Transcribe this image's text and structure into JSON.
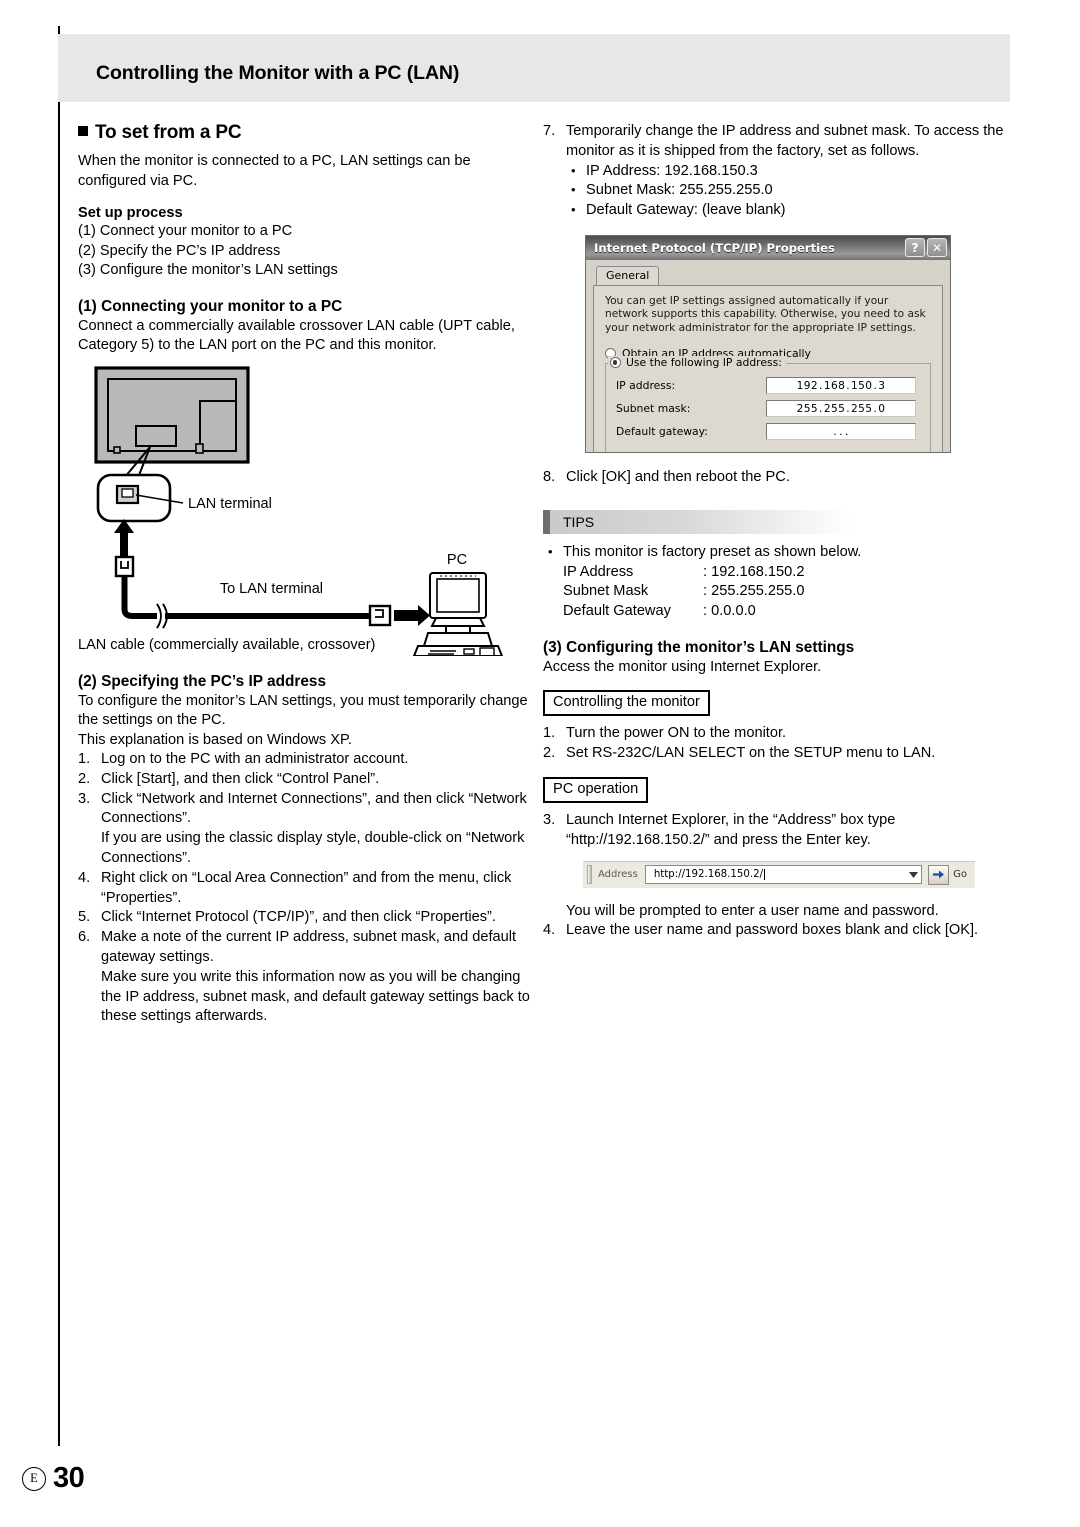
{
  "header": {
    "title": "Controlling the Monitor with a PC (LAN)"
  },
  "left": {
    "section_title": "To set from a PC",
    "intro": "When the monitor is connected to a PC, LAN settings can be configured via PC.",
    "setup_heading": "Set up process",
    "setup_steps": [
      "(1) Connect your monitor to a PC",
      "(2) Specify the PC’s IP address",
      "(3) Configure the monitor’s LAN settings"
    ],
    "step1_heading": "(1) Connecting your monitor to a PC",
    "step1_body": "Connect a commercially available crossover LAN cable (UPT cable, Category 5) to the LAN  port on the PC and this monitor.",
    "diagram": {
      "lan_terminal_label": "LAN terminal",
      "to_lan_terminal_label": "To LAN terminal",
      "pc_label": "PC",
      "cable_caption": "LAN cable (commercially available, crossover)"
    },
    "step2_heading": "(2) Specifying the PC’s IP address",
    "step2_intro1": "To configure the monitor’s LAN settings, you must temporarily change the settings on the PC.",
    "step2_intro2": "This explanation is based on Windows XP.",
    "step2_items": [
      {
        "num": "1.",
        "text": "Log on to the PC with an administrator account.",
        "extra": []
      },
      {
        "num": "2.",
        "text": "Click [Start], and then click “Control Panel”.",
        "extra": []
      },
      {
        "num": "3.",
        "text": "Click “Network and Internet Connections”, and then click “Network Connections”.",
        "extra": [
          "If you are using the classic display style, double-click on “Network Connections”."
        ]
      },
      {
        "num": "4.",
        "text": "Right click on “Local Area Connection” and from the menu, click “Properties”.",
        "extra": []
      },
      {
        "num": "5.",
        "text": "Click “Internet Protocol (TCP/IP)”, and then click “Properties”.",
        "extra": []
      },
      {
        "num": "6.",
        "text": "Make a note of the current IP address, subnet mask, and default gateway settings.",
        "extra": [
          "Make sure you write this information now as you will be changing the IP address, subnet mask, and default gateway settings back to these settings afterwards."
        ]
      }
    ]
  },
  "right": {
    "step7": {
      "num": "7.",
      "text": "Temporarily change the IP address and subnet mask. To access the monitor as it is shipped from the factory, set as follows.",
      "bullets": [
        "IP Address: 192.168.150.3",
        "Subnet Mask: 255.255.255.0",
        "Default Gateway: (leave blank)"
      ]
    },
    "dialog": {
      "title": "Internet Protocol (TCP/IP) Properties",
      "help_button": "?",
      "close_button": "✕",
      "tab": "General",
      "description": "You can get IP settings assigned automatically if your network supports this capability. Otherwise, you need to ask your network administrator for the appropriate IP settings.",
      "radio_auto": "Obtain an IP address automatically",
      "radio_manual": "Use the following IP address:",
      "fields": [
        {
          "label": "IP address:",
          "octets": [
            "192",
            "168",
            "150",
            "3"
          ]
        },
        {
          "label": "Subnet mask:",
          "octets": [
            "255",
            "255",
            "255",
            "0"
          ]
        },
        {
          "label": "Default gateway:",
          "octets": [
            "",
            "",
            "",
            ""
          ]
        }
      ],
      "separator": "."
    },
    "step8": {
      "num": "8.",
      "text": "Click [OK] and then reboot the PC."
    },
    "tips": {
      "label": "TIPS",
      "lead": "This monitor is factory preset as shown below.",
      "rows": [
        {
          "key": "IP Address",
          "value": ": 192.168.150.2"
        },
        {
          "key": "Subnet Mask",
          "value": ": 255.255.255.0"
        },
        {
          "key": "Default Gateway",
          "value": ": 0.0.0.0"
        }
      ]
    },
    "step3_heading": "(3) Configuring the monitor’s LAN settings",
    "step3_intro": "Access the monitor using Internet Explorer.",
    "box_controlling": "Controlling the monitor",
    "controlling_items": [
      {
        "num": "1.",
        "text": "Turn the power ON to the monitor."
      },
      {
        "num": "2.",
        "text": "Set RS-232C/LAN SELECT on the SETUP menu to LAN."
      }
    ],
    "box_pc_operation": "PC operation",
    "pc_items": [
      {
        "num": "3.",
        "text": "Launch Internet Explorer, in the “Address” box type “http://192.168.150.2/” and press the Enter key."
      }
    ],
    "ie": {
      "address_label": "Address",
      "address_value": "http://192.168.150.2/",
      "go_label": "Go",
      "dropdown_icon": "chevron-down-icon",
      "go_icon": "go-arrow-icon"
    },
    "after_ie_note": "You will be prompted to enter a user name and password.",
    "step4": {
      "num": "4.",
      "text": "Leave the user name and password boxes blank and click [OK]."
    }
  },
  "footer": {
    "mark": "E",
    "page": "30"
  }
}
